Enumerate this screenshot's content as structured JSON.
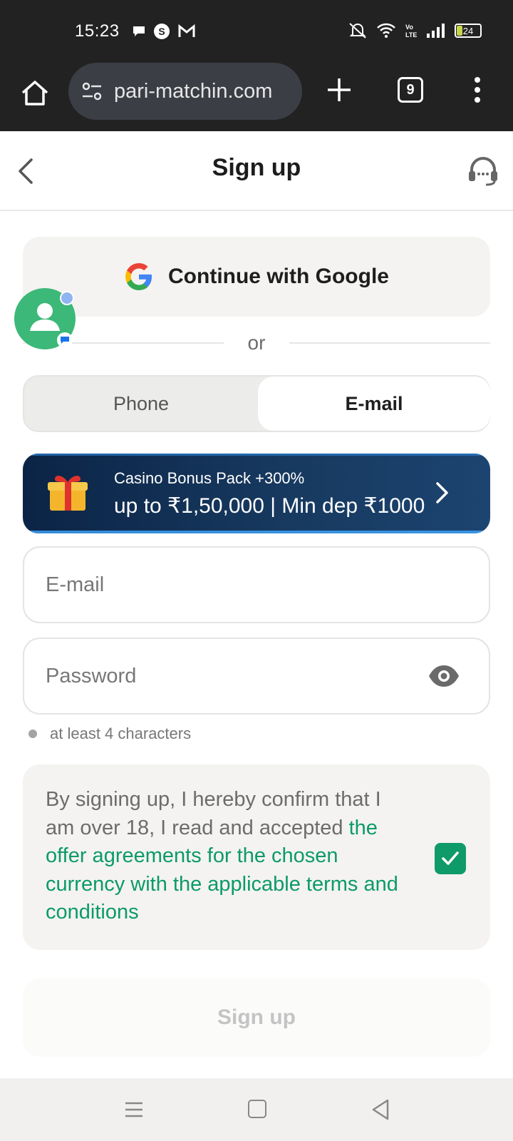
{
  "status_bar": {
    "time": "15:23",
    "battery": "24",
    "icons": [
      "message-icon",
      "skype-icon",
      "gmail-icon",
      "mute-icon",
      "wifi-icon",
      "volte-icon",
      "signal-icon",
      "battery-icon"
    ]
  },
  "browser": {
    "url": "pari-matchin.com",
    "tab_count": "9"
  },
  "header": {
    "title": "Sign up"
  },
  "social": {
    "google_label": "Continue with Google",
    "or_text": "or"
  },
  "tabs": {
    "phone": "Phone",
    "email": "E-mail",
    "active": "email"
  },
  "banner": {
    "line1": "Casino Bonus Pack +300%",
    "line2": "up to ₹1,50,000 | Min dep ₹1000"
  },
  "form": {
    "email_placeholder": "E-mail",
    "password_placeholder": "Password",
    "password_hint": "at least 4 characters"
  },
  "terms": {
    "prefix": "By signing up, I hereby confirm that I am over 18, I read and accepted ",
    "link": "the offer agreements for the chosen currency with the applicable terms and conditions",
    "checked": true
  },
  "actions": {
    "signup_label": "Sign up"
  },
  "colors": {
    "accent_green": "#0f9a6a",
    "banner_bg": "#0b2446",
    "browser_bg": "#222222"
  }
}
